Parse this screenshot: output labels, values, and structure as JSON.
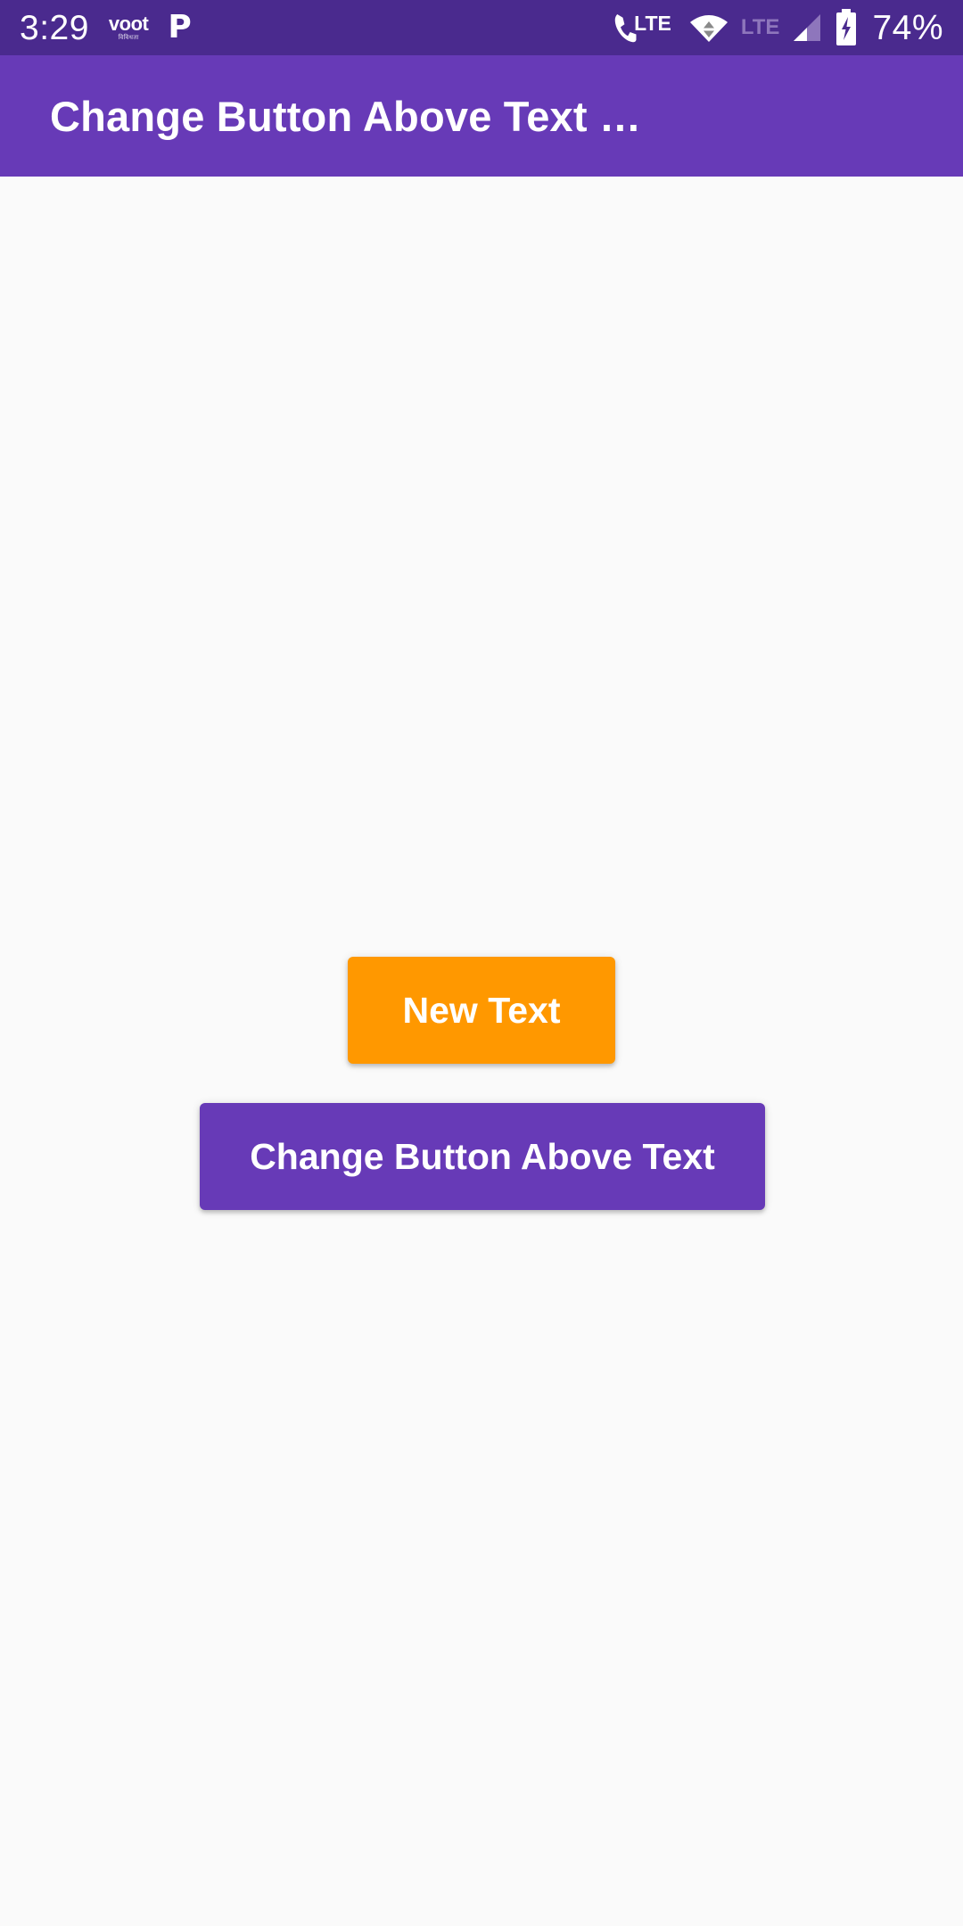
{
  "status_bar": {
    "time": "3:29",
    "notifications": [
      {
        "name": "voot-app-icon",
        "label": "voot",
        "sublabel": "विविधता"
      },
      {
        "name": "p-app-icon",
        "label": "P"
      }
    ],
    "icons": [
      {
        "name": "volte-call-icon",
        "label": "LTE"
      },
      {
        "name": "wifi-icon",
        "label": ""
      },
      {
        "name": "lte-network-label",
        "label": "LTE"
      },
      {
        "name": "cellular-signal-icon",
        "label": ""
      },
      {
        "name": "battery-charging-icon",
        "label": ""
      }
    ],
    "battery_percent": "74%",
    "background_color": "#4A2A8E",
    "foreground_color": "#FFFFFF",
    "dim_color": "#8E76BC"
  },
  "app_bar": {
    "title": "Change Button Above Text …",
    "background_color": "#673AB7",
    "text_color": "#FFFFFF"
  },
  "content": {
    "background_color": "#FAFAFA",
    "buttons": [
      {
        "name": "new-text-button",
        "label": "New Text",
        "background_color": "#FF9800",
        "text_color": "#FFFFFF"
      },
      {
        "name": "change-button-above-text-button",
        "label": "Change Button Above Text",
        "background_color": "#673AB7",
        "text_color": "#FFFFFF"
      }
    ]
  }
}
